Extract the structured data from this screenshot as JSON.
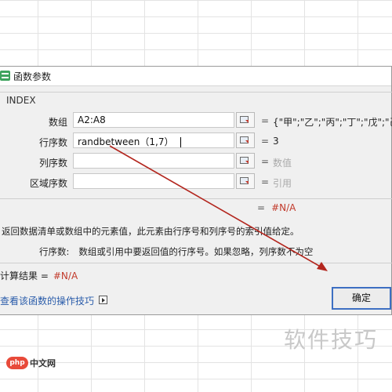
{
  "dialog": {
    "title": "函数参数",
    "function_name": "INDEX",
    "args": [
      {
        "label": "数组",
        "value": "A2:A8",
        "result": "{\"甲\";\"乙\";\"丙\";\"丁\";\"戊\";\"己\"}"
      },
      {
        "label": "行序数",
        "value": "randbetween（1,7）",
        "result": "3"
      },
      {
        "label": "列序数",
        "value": "",
        "result": "数值"
      },
      {
        "label": "区域序数",
        "value": "",
        "result": "引用"
      }
    ],
    "equals": "=",
    "overall_result": "#N/A",
    "description": "返回数据清单或数组中的元素值，此元素由行序号和列序号的索引值给定。",
    "arg_desc_label": "行序数:",
    "arg_desc_text": "数组或引用中要返回值的行序号。如果忽略，列序数不为空",
    "calc_label": "计算结果 =",
    "calc_value": "#N/A",
    "help_link": "查看该函数的操作技巧",
    "ok_label": "确定"
  },
  "watermark": {
    "big": "软件技巧",
    "logo_php": "php",
    "logo_text": "中文网"
  },
  "colors": {
    "error_red": "#c23a2b",
    "link_blue": "#2a5caa",
    "focus_blue": "#3d6fc2",
    "annotation_red": "#b3261e"
  }
}
